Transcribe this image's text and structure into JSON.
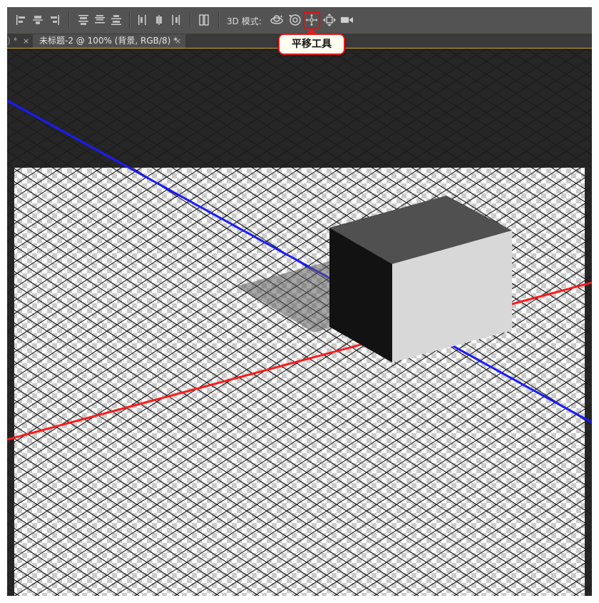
{
  "toolbar": {
    "mode_label": "3D 模式:",
    "align_buttons": [
      "align-left-edges",
      "align-horizontal-centers",
      "align-right-edges",
      "align-top-edges",
      "align-vertical-centers",
      "align-bottom-edges",
      "distribute-left",
      "distribute-center",
      "distribute-right",
      "auto-align"
    ],
    "mode_buttons": [
      {
        "name": "rotate-3d-object",
        "icon": "rotate-icon"
      },
      {
        "name": "roll-3d-object",
        "icon": "roll-icon"
      },
      {
        "name": "pan-3d-object",
        "icon": "pan-icon",
        "active": true
      },
      {
        "name": "slide-3d-object",
        "icon": "slide-icon"
      },
      {
        "name": "scale-3d-object",
        "icon": "video-camera-icon"
      }
    ]
  },
  "tabs": {
    "previous_tab_label": ") *",
    "active_tab_label": "未标题-2 @ 100% (背景, RGB/8) *",
    "close_glyph": "×"
  },
  "tooltip": {
    "text": "平移工具"
  },
  "colors": {
    "x_axis": "#ff1a1a",
    "z_axis": "#1a1aff",
    "highlight": "#e01010",
    "cube_top": "#505050",
    "cube_left": "#121212",
    "cube_right": "#d8d8d8"
  }
}
